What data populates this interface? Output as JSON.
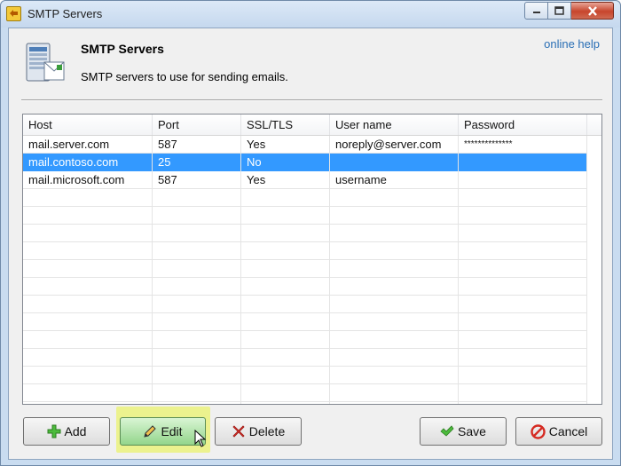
{
  "window": {
    "title": "SMTP Servers"
  },
  "header": {
    "title": "SMTP Servers",
    "subtitle": "SMTP servers  to use for sending emails.",
    "help_link": "online help"
  },
  "table": {
    "columns": [
      "Host",
      "Port",
      "SSL/TLS",
      "User name",
      "Password"
    ],
    "rows": [
      {
        "host": "mail.server.com",
        "port": "587",
        "ssl": "Yes",
        "user": "noreply@server.com",
        "password": "**************",
        "selected": false
      },
      {
        "host": "mail.contoso.com",
        "port": "25",
        "ssl": "No",
        "user": "",
        "password": "",
        "selected": true
      },
      {
        "host": "mail.microsoft.com",
        "port": "587",
        "ssl": "Yes",
        "user": "username",
        "password": "",
        "selected": false
      }
    ]
  },
  "buttons": {
    "add": "Add",
    "edit": "Edit",
    "delete": "Delete",
    "save": "Save",
    "cancel": "Cancel"
  },
  "icons": {
    "app": "smtp-app-icon",
    "header": "server-email-icon",
    "add": "plus-icon",
    "edit": "pencil-icon",
    "delete": "red-x-icon",
    "save": "checkmark-icon",
    "cancel": "cancel-circle-icon"
  },
  "colors": {
    "selection": "#3399ff",
    "link": "#2a6fb5",
    "edit_highlight": "#ecf28e"
  }
}
